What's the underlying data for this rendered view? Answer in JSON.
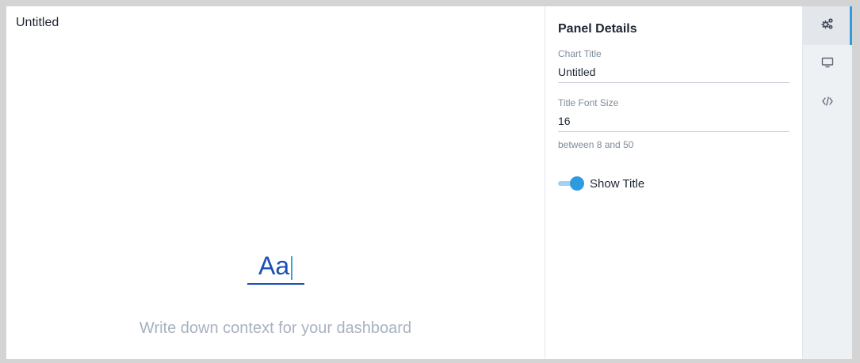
{
  "canvas": {
    "title": "Untitled",
    "typography_sample": "Aa",
    "placeholder": "Write down context for your dashboard"
  },
  "panel": {
    "heading": "Panel Details",
    "chart_title": {
      "label": "Chart Title",
      "value": "Untitled"
    },
    "title_font_size": {
      "label": "Title Font Size",
      "value": "16",
      "hint": "between 8 and 50"
    },
    "show_title": {
      "label": "Show Title",
      "enabled": true
    }
  },
  "rail": {
    "items": [
      {
        "icon": "gears-icon",
        "active": true
      },
      {
        "icon": "monitor-icon",
        "active": false
      },
      {
        "icon": "code-icon",
        "active": false
      }
    ]
  },
  "colors": {
    "accent": "#2e9be0",
    "text_primary": "#1f2533",
    "text_muted": "#7f8c9c",
    "typography_blue": "#1a4fb8"
  }
}
